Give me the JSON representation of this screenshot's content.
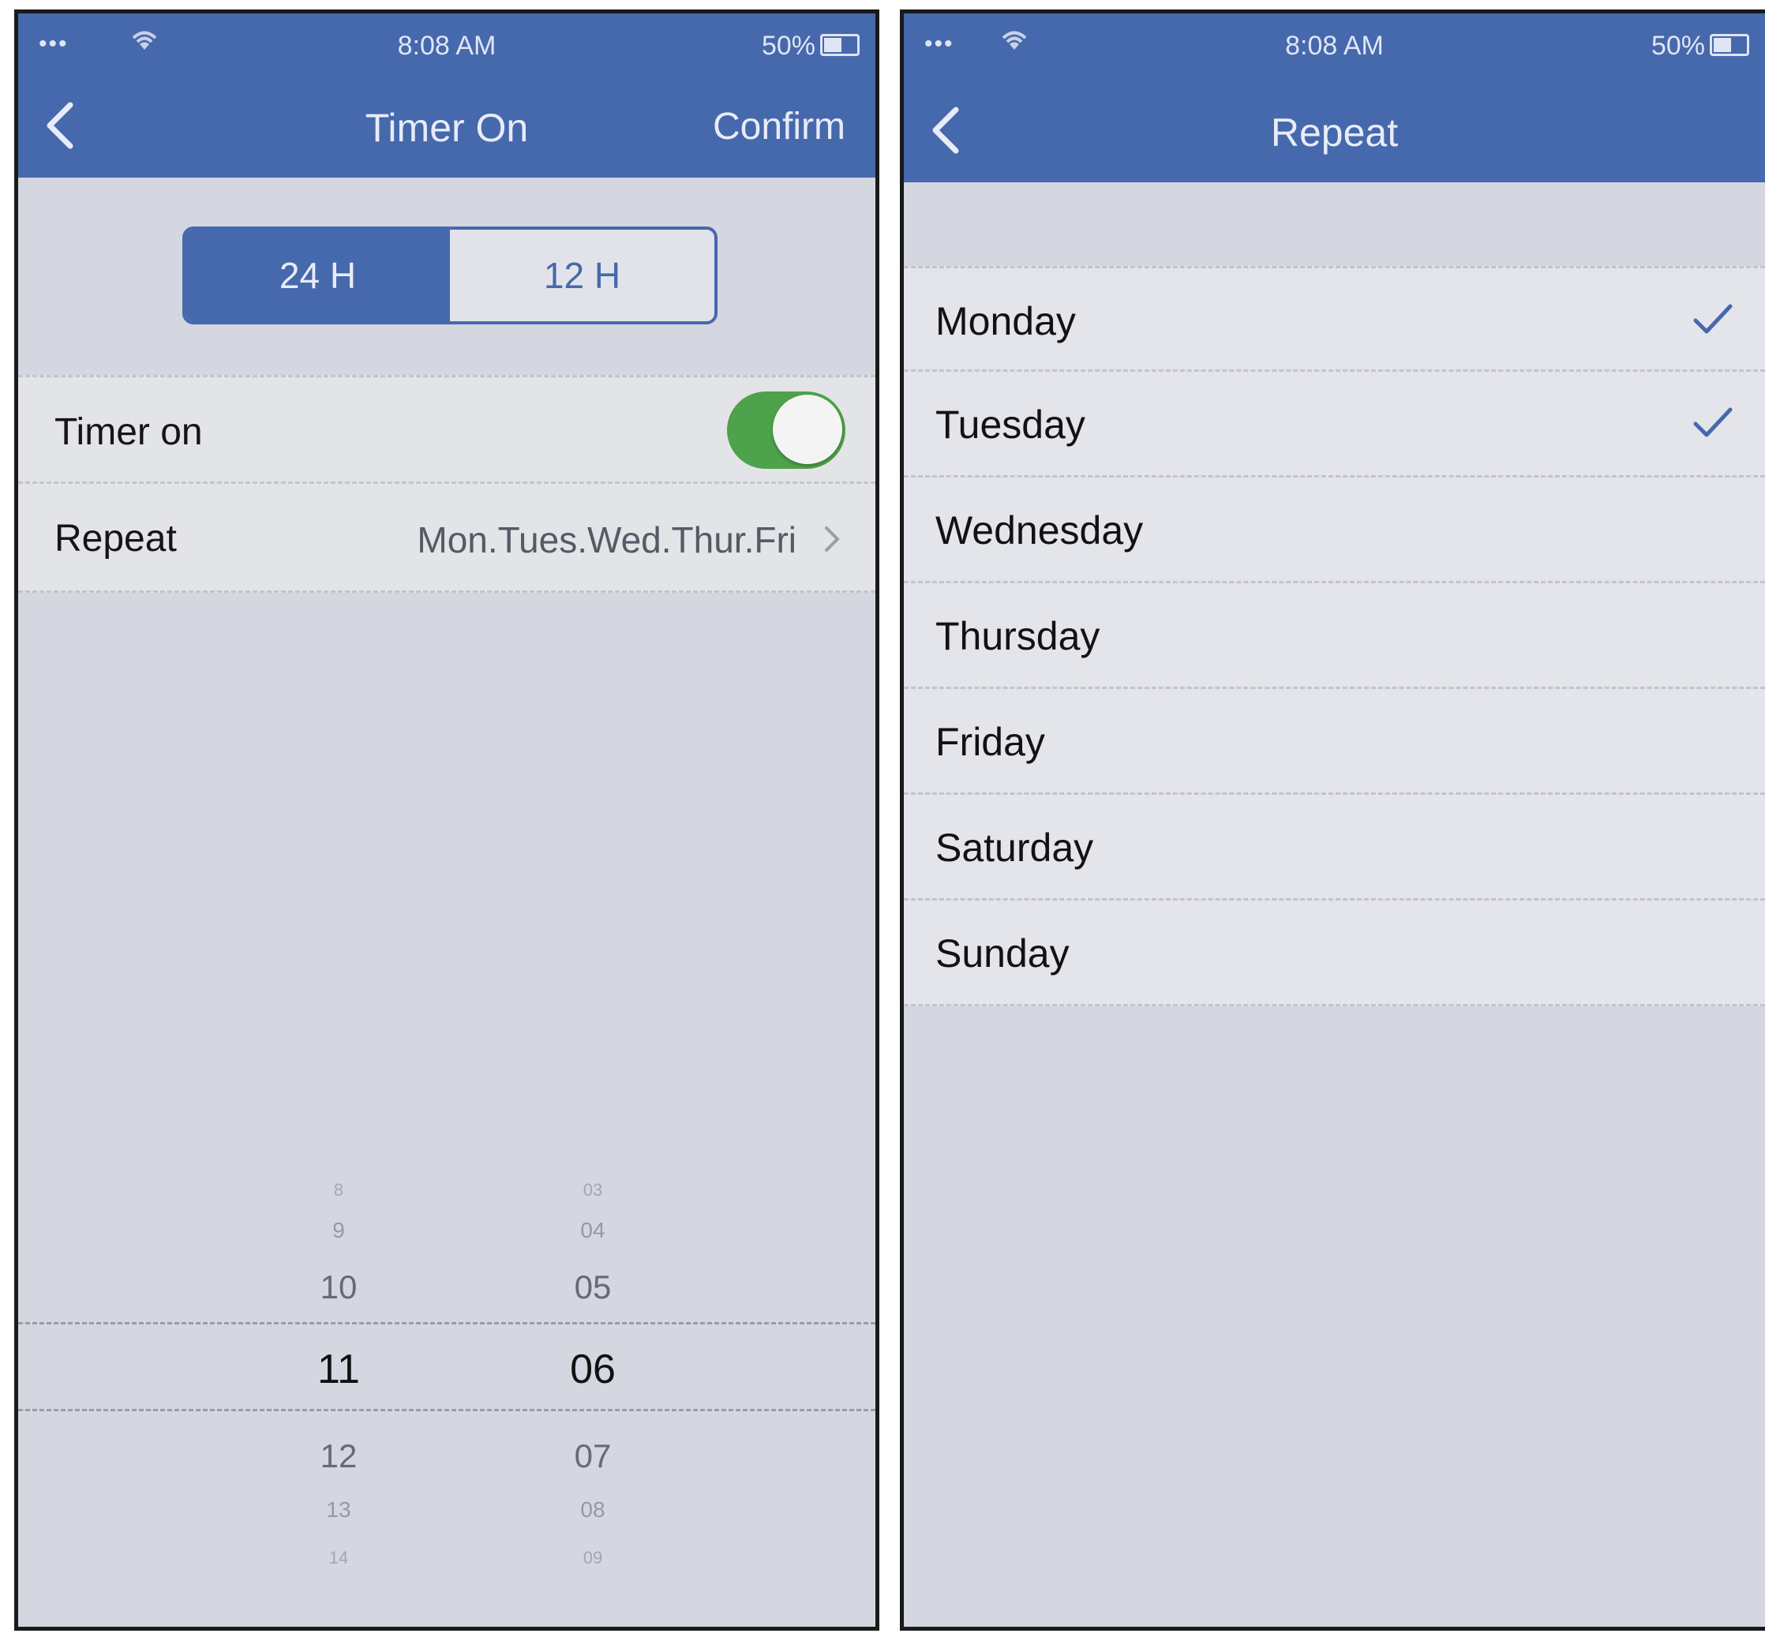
{
  "colors": {
    "brand": "#4668ac",
    "toggle_on": "#4ea24b",
    "background": "#d4d6e0"
  },
  "left": {
    "status": {
      "signal": "•••",
      "time": "8:08 AM",
      "battery": "50%"
    },
    "nav": {
      "title": "Timer On",
      "confirm_label": "Confirm",
      "back_icon": "chevron-left-icon"
    },
    "format": {
      "option_24": "24 H",
      "option_12": "12 H",
      "selected": "24 H"
    },
    "timer_on": {
      "label": "Timer on",
      "enabled": true
    },
    "repeat": {
      "label": "Repeat",
      "value": "Mon.Tues.Wed.Thur.Fri"
    },
    "picker": {
      "hours": [
        "8",
        "9",
        "10",
        "11",
        "12",
        "13",
        "14"
      ],
      "minutes": [
        "03",
        "04",
        "05",
        "06",
        "07",
        "08",
        "09"
      ],
      "selected_hour": "11",
      "selected_minute": "06"
    }
  },
  "right": {
    "status": {
      "signal": "•••",
      "time": "8:08 AM",
      "battery": "50%"
    },
    "nav": {
      "title": "Repeat",
      "back_icon": "chevron-left-icon"
    },
    "days": [
      {
        "label": "Monday",
        "checked": true
      },
      {
        "label": "Tuesday",
        "checked": true
      },
      {
        "label": "Wednesday",
        "checked": false
      },
      {
        "label": "Thursday",
        "checked": false
      },
      {
        "label": "Friday",
        "checked": false
      },
      {
        "label": "Saturday",
        "checked": false
      },
      {
        "label": "Sunday",
        "checked": false
      }
    ]
  }
}
